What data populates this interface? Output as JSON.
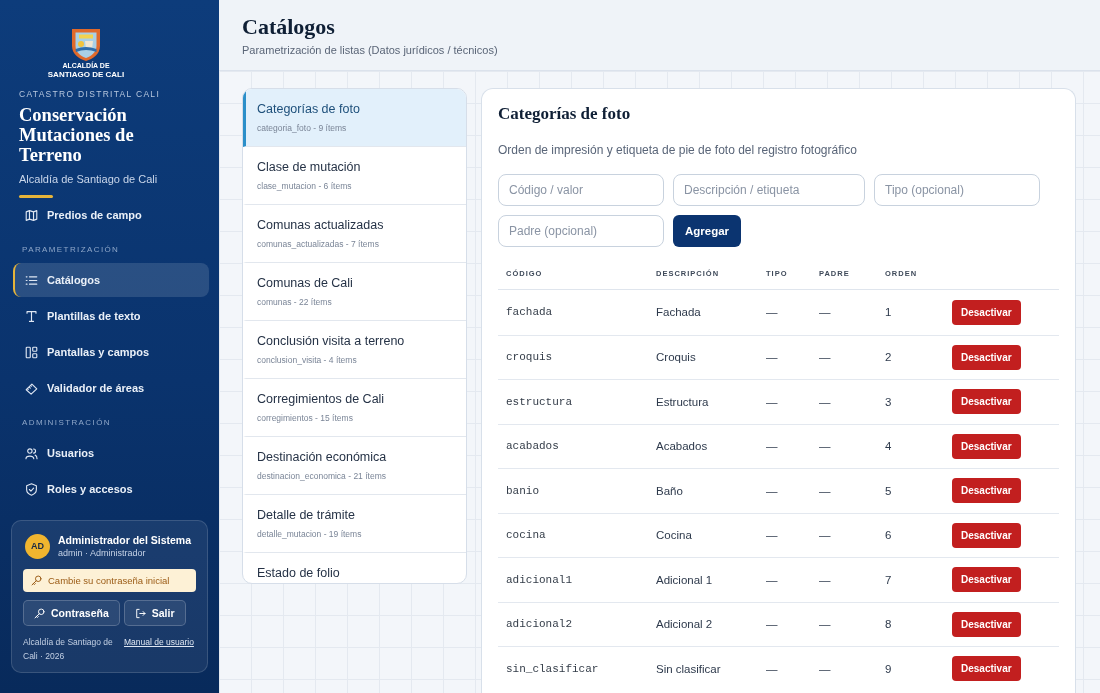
{
  "sidebar": {
    "logo": {
      "line_1": "ALCALDÍA DE",
      "line_2": "SANTIAGO DE CALI"
    },
    "eyebrow": "CATASTRO DISTRITAL CALI",
    "app_title": "Conservación Mutaciones de Terreno",
    "organization": "Alcaldía de Santiago de Cali",
    "nav_sections": [
      {
        "items": [
          {
            "label": "Predios de campo",
            "selected": false
          }
        ]
      },
      {
        "heading": "PARAMETRIZACIÓN",
        "items": [
          {
            "label": "Catálogos",
            "selected": true
          },
          {
            "label": "Plantillas de texto",
            "selected": false
          },
          {
            "label": "Pantallas y campos",
            "selected": false
          },
          {
            "label": "Validador de áreas",
            "selected": false
          }
        ]
      },
      {
        "heading": "ADMINISTRACIÓN",
        "items": [
          {
            "label": "Usuarios",
            "selected": false
          },
          {
            "label": "Roles y accesos",
            "selected": false
          }
        ]
      }
    ],
    "user": {
      "initials": "AD",
      "name": "Administrador del Sistema",
      "role": "admin · Administrador",
      "notice": "Cambie su contraseña inicial",
      "buttons": [
        "Contraseña",
        "Salir"
      ],
      "footer": "Alcaldía de Santiago de Cali · 2026",
      "manual_link": "Manual de usuario"
    }
  },
  "page": {
    "title": "Catálogos",
    "subtitle": "Parametrización de listas (Datos jurídicos / técnicos)"
  },
  "catalogs": {
    "items": [
      {
        "name": "Categorías de foto",
        "meta": "categoria_foto - 9 ítems",
        "selected": true
      },
      {
        "name": "Clase de mutación",
        "meta": "clase_mutacion - 6 ítems",
        "selected": false
      },
      {
        "name": "Comunas actualizadas",
        "meta": "comunas_actualizadas - 7 ítems",
        "selected": false
      },
      {
        "name": "Comunas de Cali",
        "meta": "comunas - 22 ítems",
        "selected": false
      },
      {
        "name": "Conclusión visita a terreno",
        "meta": "conclusion_visita - 4 ítems",
        "selected": false
      },
      {
        "name": "Corregimientos de Cali",
        "meta": "corregimientos - 15 ítems",
        "selected": false
      },
      {
        "name": "Destinación económica",
        "meta": "destinacion_economica - 21 ítems",
        "selected": false
      },
      {
        "name": "Detalle de trámite",
        "meta": "detalle_mutacion - 19 ítems",
        "selected": false
      },
      {
        "name": "Estado de folio",
        "selected": false
      }
    ]
  },
  "detail": {
    "title": "Categorías de foto",
    "description": "Orden de impresión y etiqueta de pie de foto del registro fotográfico",
    "fields": [
      {
        "placeholder": "Código / valor"
      },
      {
        "placeholder": "Descripción / etiqueta"
      },
      {
        "placeholder": "Tipo (opcional)"
      },
      {
        "placeholder": "Padre (opcional)"
      }
    ],
    "add_button": "Agregar",
    "table": {
      "columns": [
        "CÓDIGO",
        "DESCRIPCIÓN",
        "TIPO",
        "PADRE",
        "ORDEN"
      ],
      "rows": [
        {
          "code": "fachada",
          "description": "Fachada",
          "type": "—",
          "parent": "—",
          "order": "1",
          "action": "Desactivar"
        },
        {
          "code": "croquis",
          "description": "Croquis",
          "type": "—",
          "parent": "—",
          "order": "2",
          "action": "Desactivar"
        },
        {
          "code": "estructura",
          "description": "Estructura",
          "type": "—",
          "parent": "—",
          "order": "3",
          "action": "Desactivar"
        },
        {
          "code": "acabados",
          "description": "Acabados",
          "type": "—",
          "parent": "—",
          "order": "4",
          "action": "Desactivar"
        },
        {
          "code": "banio",
          "description": "Baño",
          "type": "—",
          "parent": "—",
          "order": "5",
          "action": "Desactivar"
        },
        {
          "code": "cocina",
          "description": "Cocina",
          "type": "—",
          "parent": "—",
          "order": "6",
          "action": "Desactivar"
        },
        {
          "code": "adicional1",
          "description": "Adicional 1",
          "type": "—",
          "parent": "—",
          "order": "7",
          "action": "Desactivar"
        },
        {
          "code": "adicional2",
          "description": "Adicional 2",
          "type": "—",
          "parent": "—",
          "order": "8",
          "action": "Desactivar"
        },
        {
          "code": "sin_clasificar",
          "description": "Sin clasificar",
          "type": "—",
          "parent": "—",
          "order": "9",
          "action": "Desactivar"
        }
      ]
    }
  }
}
